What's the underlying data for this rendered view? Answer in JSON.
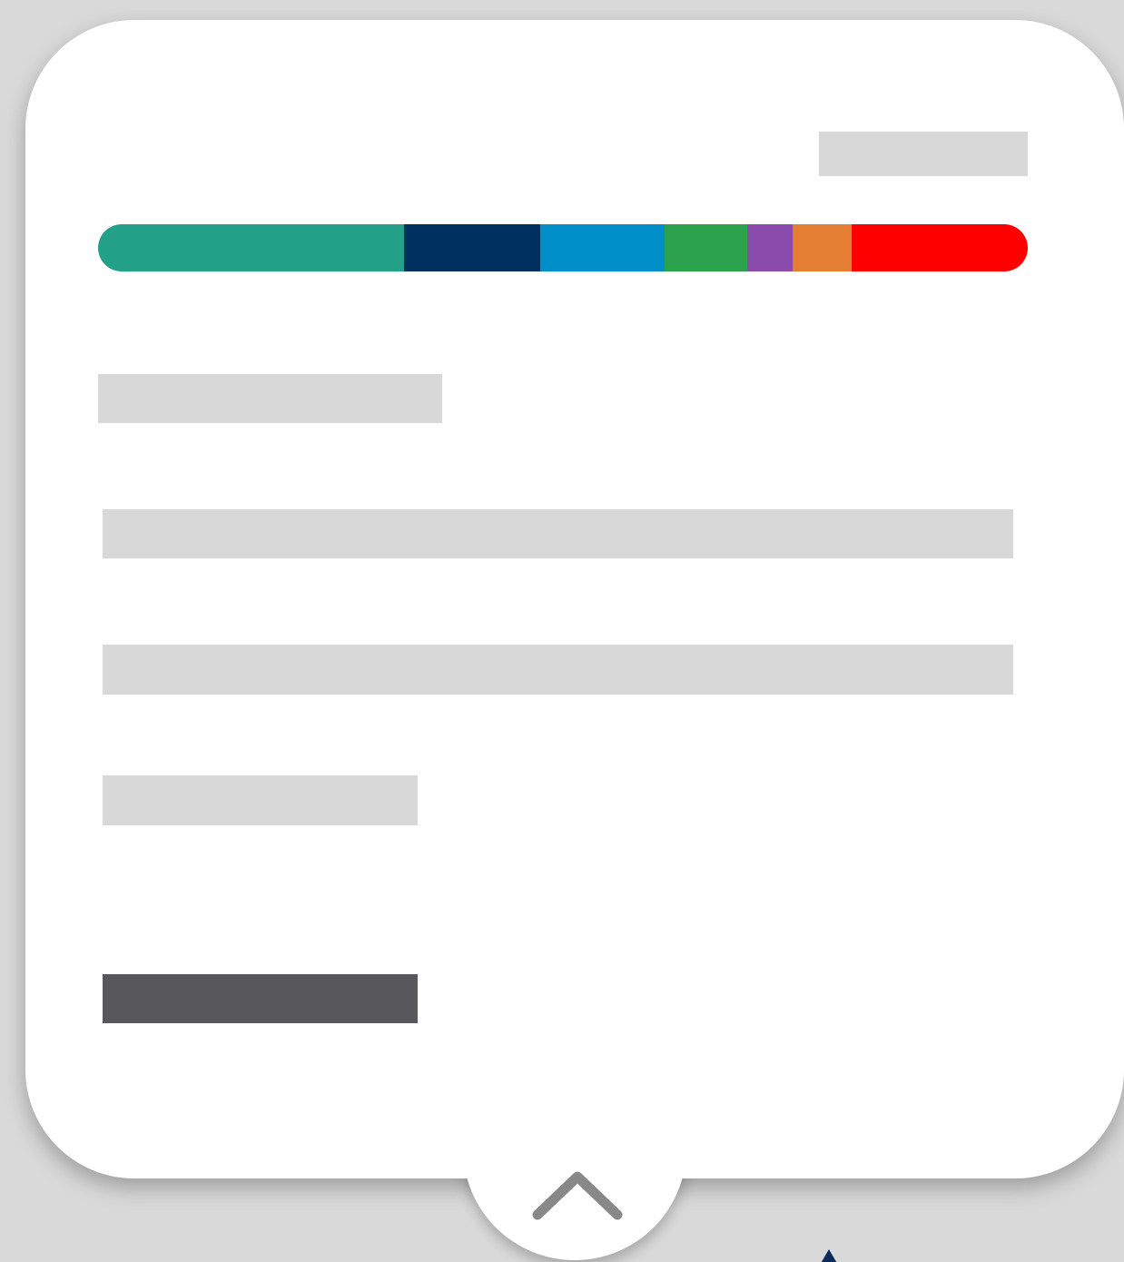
{
  "popover": {
    "title_placeholder": "",
    "value_placeholder": "",
    "lines": [
      "",
      "",
      ""
    ],
    "action_label": ""
  },
  "scale": {
    "segments": [
      {
        "name": "teal",
        "color": "#22a088",
        "share": 0.329
      },
      {
        "name": "navy",
        "color": "#003060",
        "share": 0.147
      },
      {
        "name": "blue",
        "color": "#008fc8",
        "share": 0.133
      },
      {
        "name": "green",
        "color": "#2ba24b",
        "share": 0.089
      },
      {
        "name": "purple",
        "color": "#8b4bad",
        "share": 0.049
      },
      {
        "name": "orange",
        "color": "#e37e32",
        "share": 0.064
      },
      {
        "name": "red",
        "color": "#ff0000",
        "share": 0.189
      }
    ]
  },
  "icons": {
    "collapse": "chevron-up-icon",
    "indicator": "marker-triangle-icon"
  },
  "colors": {
    "background": "#d9d9d9",
    "card": "#ffffff",
    "placeholder": "#d8d8d8",
    "action": "#57575c",
    "chevron": "#888888",
    "marker": "#0d2b5a"
  }
}
